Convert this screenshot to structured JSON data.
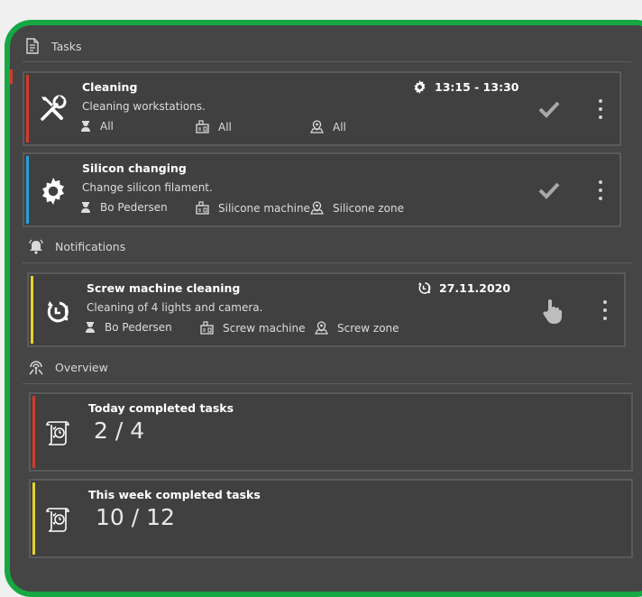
{
  "sections": {
    "tasks": "Tasks",
    "notifications": "Notifications",
    "overview": "Overview"
  },
  "tasks": [
    {
      "title": "Cleaning",
      "description": "Cleaning workstations.",
      "time": "13:15 - 13:30",
      "person": "All",
      "machine": "All",
      "zone": "All",
      "accent_color": "#d23b2b",
      "icon": "tools-icon"
    },
    {
      "title": "Silicon changing",
      "description": "Change silicon filament.",
      "person": "Bo Pedersen",
      "machine": "Silicone machine",
      "zone": "Silicone zone",
      "accent_color": "#2aa1d8",
      "icon": "gear-icon"
    }
  ],
  "notifications": [
    {
      "title": "Screw machine cleaning",
      "description": "Cleaning of 4 lights and camera.",
      "date": "27.11.2020",
      "person": "Bo Pedersen",
      "machine": "Screw machine",
      "zone": "Screw zone",
      "accent_color": "#e6d22e",
      "icon": "alarm-alert-icon"
    }
  ],
  "overview": [
    {
      "title": "Today completed tasks",
      "value": "2 / 4",
      "accent_color": "#d23b2b"
    },
    {
      "title": "This week completed tasks",
      "value": "10 / 12",
      "accent_color": "#e6d22e"
    }
  ],
  "colors": {
    "frame": "#17a844",
    "panel": "#454546",
    "card": "#404041"
  }
}
